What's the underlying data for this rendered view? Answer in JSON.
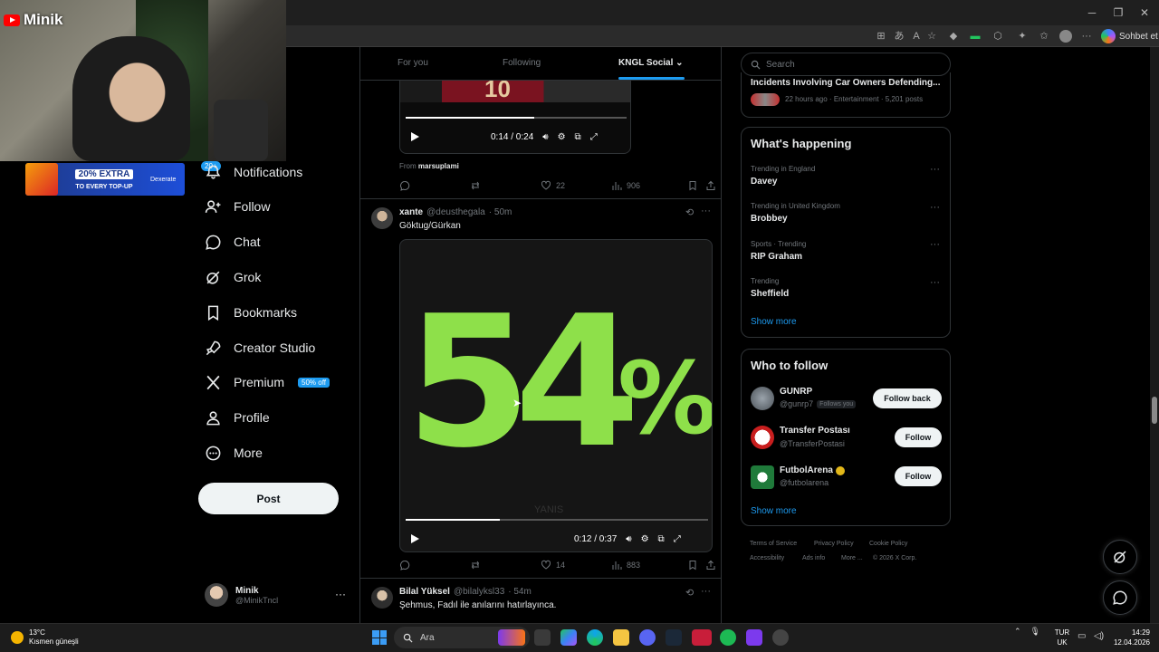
{
  "overlay": {
    "channel_name": "Minik",
    "ad_line1": "20% EXTRA",
    "ad_line2": "TO EVERY TOP-UP",
    "ad_brand": "Dexerate"
  },
  "browser": {
    "copilot_label": "Sohbet et"
  },
  "nav": {
    "notif_count": "20+",
    "items": [
      {
        "label": "Notifications",
        "icon": "bell-icon"
      },
      {
        "label": "Follow",
        "icon": "person-add-icon"
      },
      {
        "label": "Chat",
        "icon": "chat-bubble-icon"
      },
      {
        "label": "Grok",
        "icon": "grok-icon"
      },
      {
        "label": "Bookmarks",
        "icon": "bookmark-icon"
      },
      {
        "label": "Creator Studio",
        "icon": "rocket-icon"
      },
      {
        "label": "Premium",
        "icon": "x-logo-icon"
      },
      {
        "label": "Profile",
        "icon": "person-icon"
      },
      {
        "label": "More",
        "icon": "more-circle-icon"
      }
    ],
    "premium_badge": "50% off",
    "post_button": "Post",
    "account": {
      "name": "Minik",
      "handle": "@MinikTncl"
    }
  },
  "feed": {
    "tabs": [
      "For you",
      "Following",
      "KNGL Social"
    ],
    "active_tab": "KNGL Social",
    "post1": {
      "video_time": "0:14 / 0:24",
      "video_progress": 0.58,
      "from_label": "From",
      "from_user": "marsuplami",
      "jersey_number": "10",
      "replies": "",
      "reposts": "",
      "likes": "22",
      "views": "906"
    },
    "post2": {
      "name": "xante",
      "handle": "@deusthegala",
      "time": "· 50m",
      "text": "Göktug/Gürkan",
      "graphic_text": [
        "5",
        "4",
        "%"
      ],
      "watermark": "YANIS",
      "video_time": "0:12 / 0:37",
      "video_progress": 0.31,
      "likes": "14",
      "views": "883"
    },
    "post3": {
      "name": "Bilal Yüksel",
      "handle": "@bilalyksl33",
      "time": "· 54m",
      "text": "Şehmus, Fadıl ile anılarını hatırlayınca."
    }
  },
  "sidebar": {
    "search_placeholder": "Search",
    "top_trend": {
      "title": "Incidents Involving Car Owners Defending...",
      "meta": "22 hours ago · Entertainment · 5,201 posts"
    },
    "whats_happening": {
      "title": "What's happening",
      "trends": [
        {
          "meta": "Trending in England",
          "name": "Davey"
        },
        {
          "meta": "Trending in United Kingdom",
          "name": "Brobbey"
        },
        {
          "meta": "Sports · Trending",
          "name": "RIP Graham"
        },
        {
          "meta": "Trending",
          "name": "Sheffield"
        }
      ],
      "show_more": "Show more"
    },
    "who_to_follow": {
      "title": "Who to follow",
      "users": [
        {
          "name": "GUNRP",
          "handle": "@gunrp7",
          "follows_you": "Follows you",
          "button": "Follow back"
        },
        {
          "name": "Transfer Postası",
          "handle": "@TransferPostasi",
          "button": "Follow"
        },
        {
          "name": "FutbolArena",
          "handle": "@futbolarena",
          "button": "Follow"
        }
      ],
      "show_more": "Show more"
    },
    "footer": [
      "Terms of Service",
      "Privacy Policy",
      "Cookie Policy",
      "Accessibility",
      "Ads info",
      "More ...",
      "© 2026 X Corp."
    ]
  },
  "taskbar": {
    "weather_temp": "13°C",
    "weather_desc": "Kısmen güneşli",
    "search_label": "Ara",
    "lang_top": "TUR",
    "lang_bottom": "UK",
    "time": "14:29",
    "date": "12.04.2026"
  },
  "colors": {
    "accent": "#1d9bf0",
    "graphic_green": "#8ee04a"
  }
}
